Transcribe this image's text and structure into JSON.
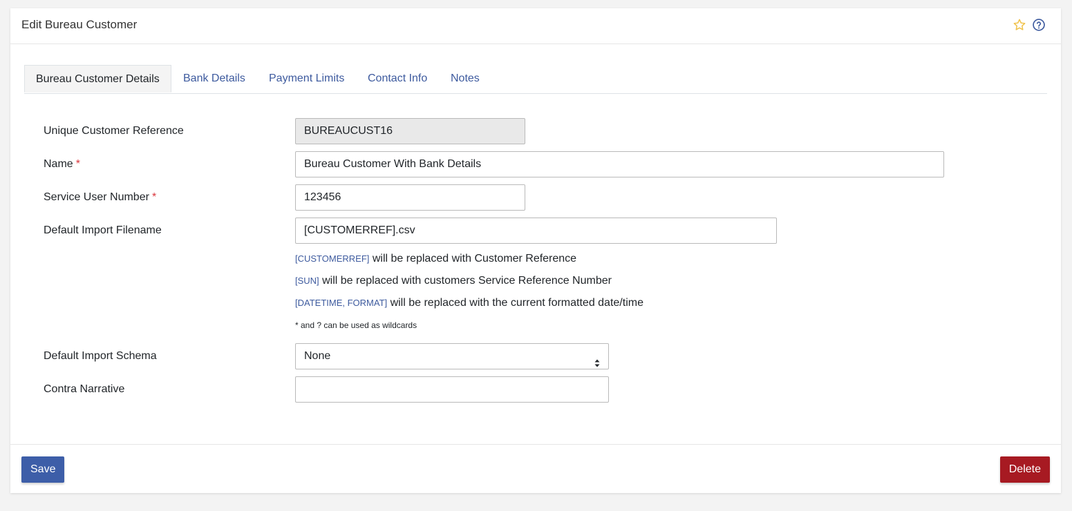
{
  "header": {
    "title": "Edit Bureau Customer",
    "favourite_icon": "star-outline-icon",
    "help_icon": "question-circle-icon"
  },
  "tabs": [
    {
      "label": "Bureau Customer Details",
      "active": true
    },
    {
      "label": "Bank Details",
      "active": false
    },
    {
      "label": "Payment Limits",
      "active": false
    },
    {
      "label": "Contact Info",
      "active": false
    },
    {
      "label": "Notes",
      "active": false
    }
  ],
  "form": {
    "unique_ref": {
      "label": "Unique Customer Reference",
      "value": "BUREAUCUST16"
    },
    "name": {
      "label": "Name",
      "required_mark": "*",
      "value": "Bureau Customer With Bank Details"
    },
    "sun": {
      "label": "Service User Number",
      "required_mark": "*",
      "value": "123456"
    },
    "import_filename": {
      "label": "Default Import Filename",
      "value": "[CUSTOMERREF].csv"
    },
    "hints": [
      {
        "token": "[CUSTOMERREF]",
        "text": " will be replaced with Customer Reference"
      },
      {
        "token": "[SUN]",
        "text": " will be replaced with customers Service Reference Number"
      },
      {
        "token": "[DATETIME, FORMAT]",
        "text": " will be replaced with the current formatted date/time"
      }
    ],
    "wildcard_hint": "* and ? can be used as wildcards",
    "import_schema": {
      "label": "Default Import Schema",
      "selected": "None"
    },
    "contra_narrative": {
      "label": "Contra Narrative",
      "value": ""
    }
  },
  "footer": {
    "save_label": "Save",
    "delete_label": "Delete"
  },
  "colors": {
    "primary": "#3d5ea8",
    "danger": "#a71a22",
    "link": "#3d5a9e",
    "required": "#d9343b",
    "star": "#f0c24b"
  }
}
